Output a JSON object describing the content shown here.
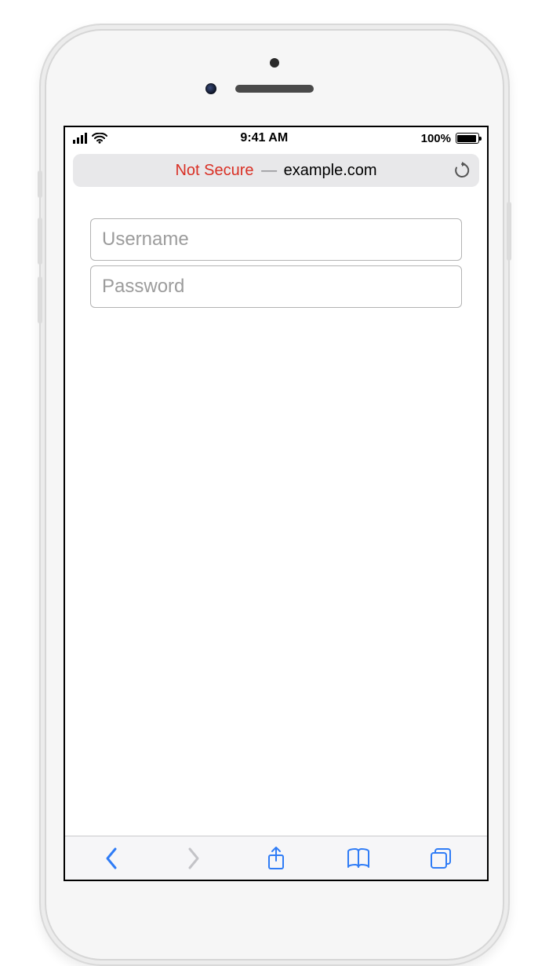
{
  "status": {
    "time": "9:41 AM",
    "battery_percent": "100%"
  },
  "address_bar": {
    "security_label": "Not Secure",
    "separator": "—",
    "domain": "example.com"
  },
  "form": {
    "username_placeholder": "Username",
    "password_placeholder": "Password"
  },
  "colors": {
    "not_secure": "#d93025",
    "ios_blue": "#2f7cf6"
  }
}
